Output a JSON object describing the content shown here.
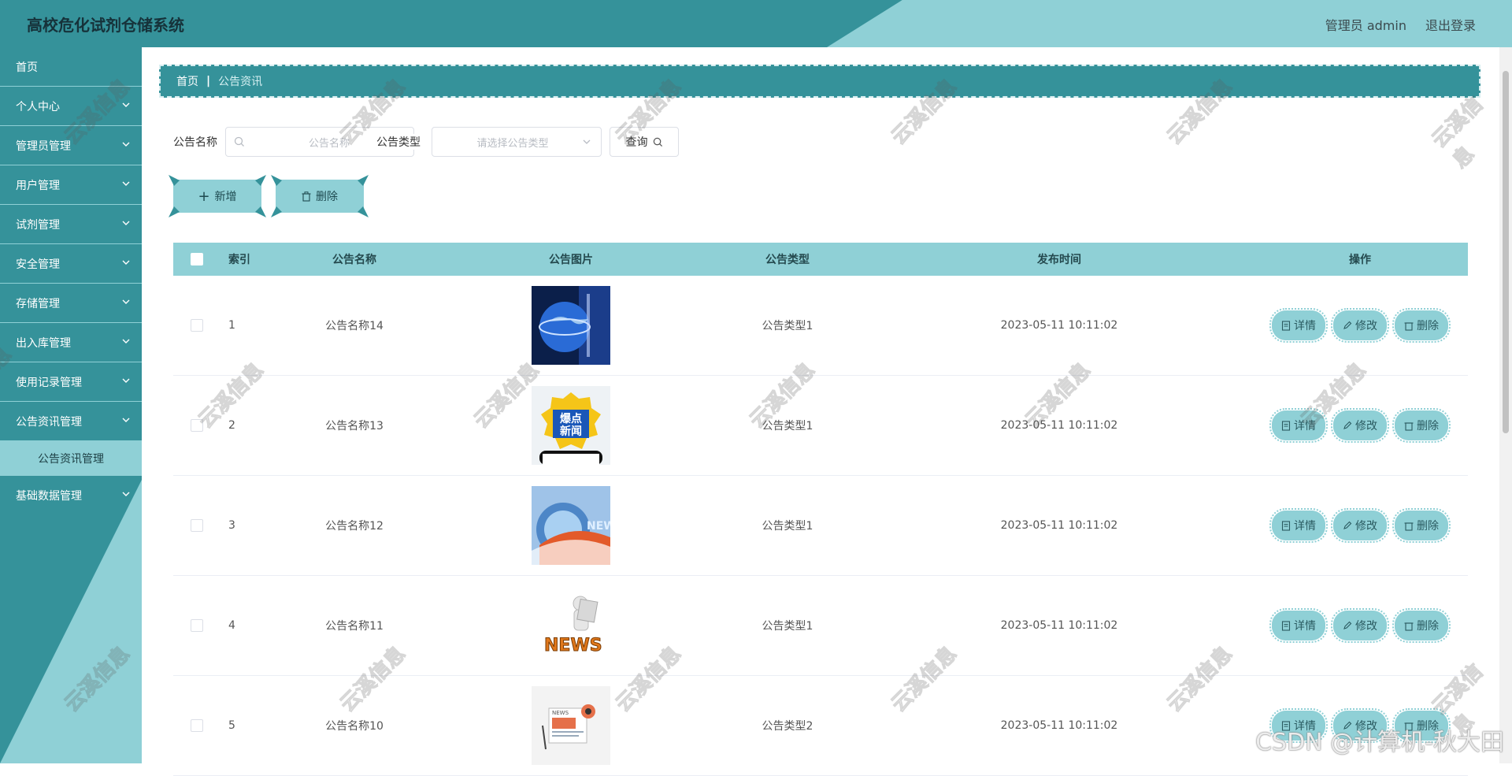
{
  "header": {
    "title": "高校危化试剂仓储系统",
    "user_label": "管理员 admin",
    "logout_label": "退出登录"
  },
  "sidebar": {
    "items": [
      {
        "label": "首页",
        "has_chevron": false
      },
      {
        "label": "个人中心",
        "has_chevron": true
      },
      {
        "label": "管理员管理",
        "has_chevron": true
      },
      {
        "label": "用户管理",
        "has_chevron": true
      },
      {
        "label": "试剂管理",
        "has_chevron": true
      },
      {
        "label": "安全管理",
        "has_chevron": true
      },
      {
        "label": "存储管理",
        "has_chevron": true
      },
      {
        "label": "出入库管理",
        "has_chevron": true
      },
      {
        "label": "使用记录管理",
        "has_chevron": true
      },
      {
        "label": "公告资讯管理",
        "has_chevron": true
      }
    ],
    "sub_item": "公告资讯管理",
    "last_item": "基础数据管理"
  },
  "breadcrumb": {
    "home": "首页",
    "separator": "|",
    "current": "公告资讯"
  },
  "search": {
    "name_label": "公告名称",
    "name_placeholder": "公告名称",
    "type_label": "公告类型",
    "type_placeholder": "请选择公告类型",
    "query_label": "查询"
  },
  "actions": {
    "add_label": "新增",
    "delete_label": "删除"
  },
  "table": {
    "headers": {
      "index": "索引",
      "name": "公告名称",
      "image": "公告图片",
      "type": "公告类型",
      "time": "发布时间",
      "ops": "操作"
    },
    "rows": [
      {
        "index": "1",
        "name": "公告名称14",
        "image": "globe-news-image",
        "type": "公告类型1",
        "time": "2023-05-11 10:11:02"
      },
      {
        "index": "2",
        "name": "公告名称13",
        "image": "hot-news-image",
        "type": "公告类型1",
        "time": "2023-05-11 10:11:02"
      },
      {
        "index": "3",
        "name": "公告名称12",
        "image": "news-broadcast-image",
        "type": "公告类型1",
        "time": "2023-05-11 10:11:02"
      },
      {
        "index": "4",
        "name": "公告名称11",
        "image": "news-figure-image",
        "type": "公告类型1",
        "time": "2023-05-11 10:11:02"
      },
      {
        "index": "5",
        "name": "公告名称10",
        "image": "news-paper-image",
        "type": "公告类型2",
        "time": "2023-05-11 10:11:02"
      }
    ],
    "op_labels": {
      "detail": "详情",
      "edit": "修改",
      "delete": "删除"
    }
  },
  "watermark": {
    "text": "云溪信息",
    "csdn": "CSDN @计算机-秋大田"
  },
  "colors": {
    "primary": "#35929a",
    "accent": "#8fd0d6"
  }
}
